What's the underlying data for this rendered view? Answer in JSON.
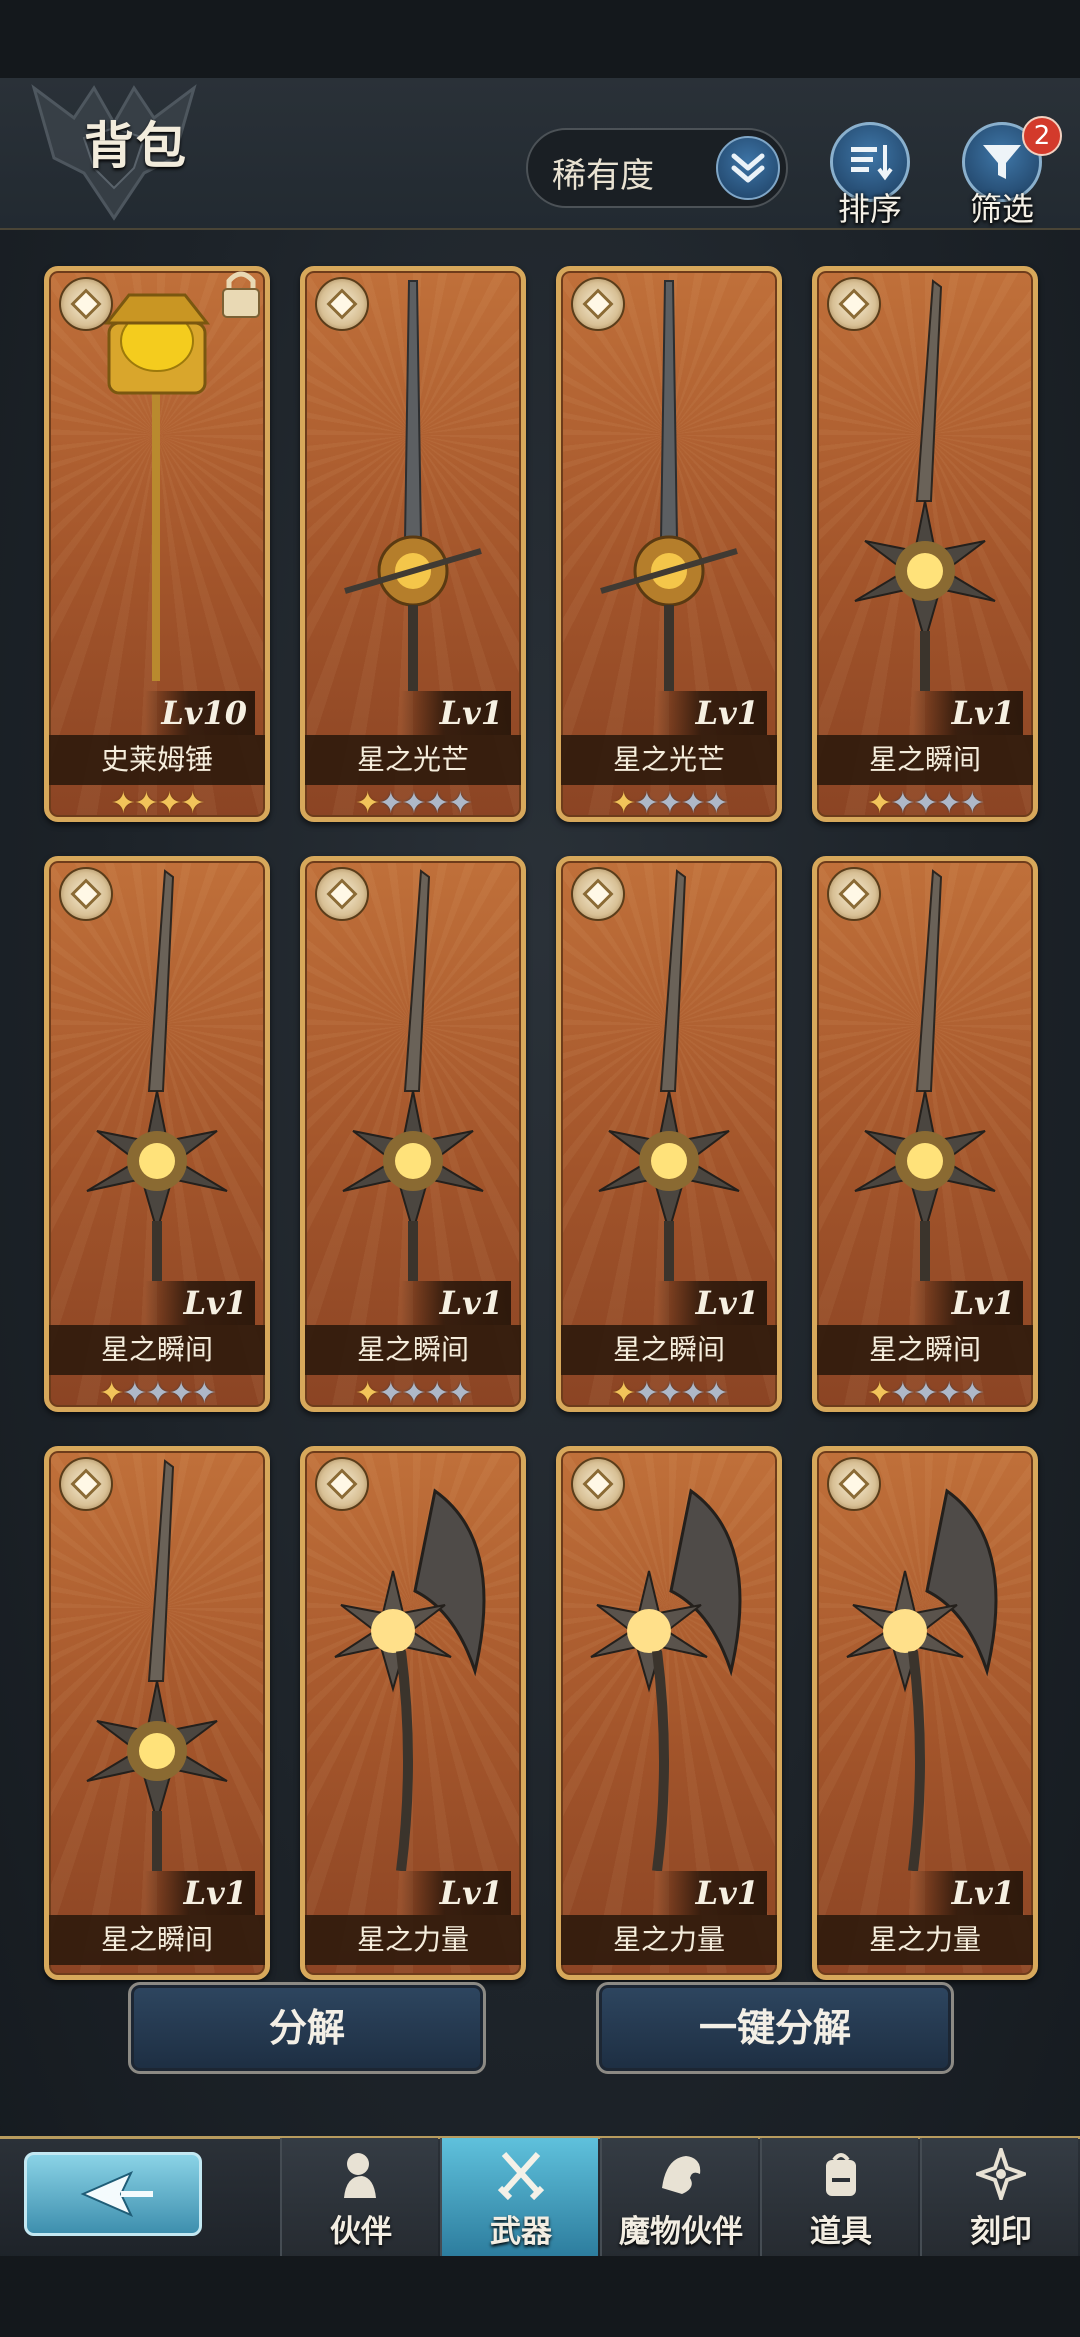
{
  "header": {
    "title": "背包",
    "sort_select": {
      "value": "稀有度"
    },
    "sort_button_label": "排序",
    "filter_button_label": "筛选",
    "filter_badge_count": "2"
  },
  "items": [
    {
      "name": "史莱姆锤",
      "level": "Lv10",
      "stars_gold": 4,
      "stars_silver": 0,
      "locked": true,
      "art": "slime-hammer"
    },
    {
      "name": "星之光芒",
      "level": "Lv1",
      "stars_gold": 1,
      "stars_silver": 4,
      "locked": false,
      "art": "sword"
    },
    {
      "name": "星之光芒",
      "level": "Lv1",
      "stars_gold": 1,
      "stars_silver": 4,
      "locked": false,
      "art": "sword"
    },
    {
      "name": "星之瞬间",
      "level": "Lv1",
      "stars_gold": 1,
      "stars_silver": 4,
      "locked": false,
      "art": "star-sword"
    },
    {
      "name": "星之瞬间",
      "level": "Lv1",
      "stars_gold": 1,
      "stars_silver": 4,
      "locked": false,
      "art": "star-sword"
    },
    {
      "name": "星之瞬间",
      "level": "Lv1",
      "stars_gold": 1,
      "stars_silver": 4,
      "locked": false,
      "art": "star-sword"
    },
    {
      "name": "星之瞬间",
      "level": "Lv1",
      "stars_gold": 1,
      "stars_silver": 4,
      "locked": false,
      "art": "star-sword"
    },
    {
      "name": "星之瞬间",
      "level": "Lv1",
      "stars_gold": 1,
      "stars_silver": 4,
      "locked": false,
      "art": "star-sword"
    },
    {
      "name": "星之瞬间",
      "level": "Lv1",
      "stars_gold": 0,
      "stars_silver": 0,
      "locked": false,
      "art": "star-sword"
    },
    {
      "name": "星之力量",
      "level": "Lv1",
      "stars_gold": 0,
      "stars_silver": 0,
      "locked": false,
      "art": "axe"
    },
    {
      "name": "星之力量",
      "level": "Lv1",
      "stars_gold": 0,
      "stars_silver": 0,
      "locked": false,
      "art": "axe"
    },
    {
      "name": "星之力量",
      "level": "Lv1",
      "stars_gold": 0,
      "stars_silver": 0,
      "locked": false,
      "art": "axe"
    }
  ],
  "actions": {
    "decompose_label": "分解",
    "one_click_decompose_label": "一键分解"
  },
  "nav": {
    "back_icon": "back-arrow-icon",
    "tabs": [
      {
        "label": "伙伴",
        "icon": "partner-icon",
        "active": false
      },
      {
        "label": "武器",
        "icon": "crossed-swords-icon",
        "active": true
      },
      {
        "label": "魔物伙伴",
        "icon": "dragon-icon",
        "active": false
      },
      {
        "label": "道具",
        "icon": "backpack-icon",
        "active": false
      },
      {
        "label": "刻印",
        "icon": "rune-star-icon",
        "active": false
      }
    ]
  },
  "colors": {
    "card_border": "#d7a85b",
    "card_bg": "#a3552b",
    "active_tab": "#5fc1dc",
    "badge": "#d33a2b",
    "star_gold": "#f2c45a",
    "star_silver": "#aeb8c8"
  }
}
